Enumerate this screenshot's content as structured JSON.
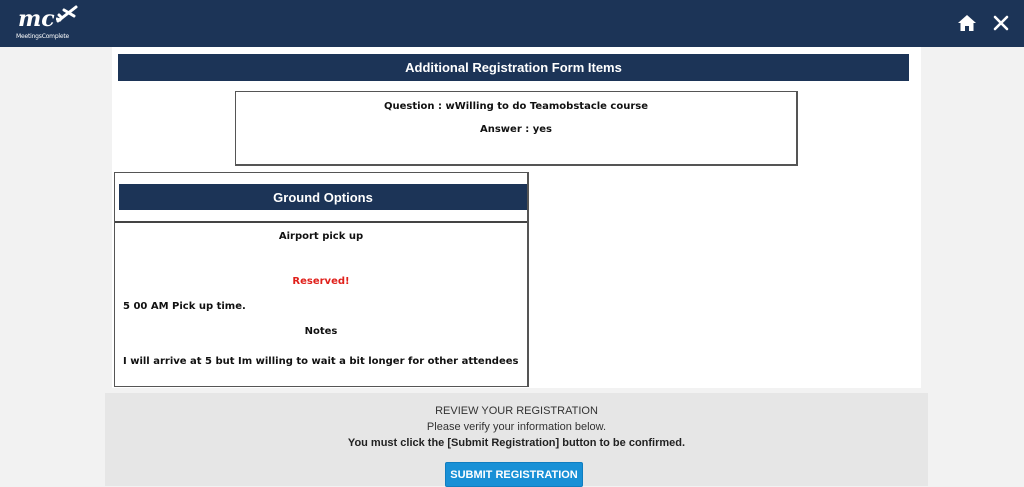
{
  "header": {
    "logo_text": "mc",
    "logo_subtitle": "MeetingsComplete",
    "home_icon": "home-icon",
    "close_icon": "close-icon",
    "bg_color": "#1c3457"
  },
  "registration_items": {
    "title": "Additional Registration Form Items",
    "question": "Question : wWilling to do Teamobstacle course",
    "answer": "Answer : yes"
  },
  "ground_options": {
    "title": "Ground Options",
    "service": "Airport pick up",
    "status": "Reserved!",
    "status_color": "#e0201b",
    "pickup_time": "5 00 AM Pick up time.",
    "notes_label": "Notes",
    "notes": "I will arrive at 5 but Im willing to wait a bit longer for other attendees"
  },
  "review": {
    "heading": "REVIEW YOUR REGISTRATION",
    "instruction": "Please verify your information below.",
    "warning": "You must click the [Submit Registration] button to be confirmed.",
    "submit_label": "SUBMIT REGISTRATION",
    "button_color": "#1890d6"
  }
}
